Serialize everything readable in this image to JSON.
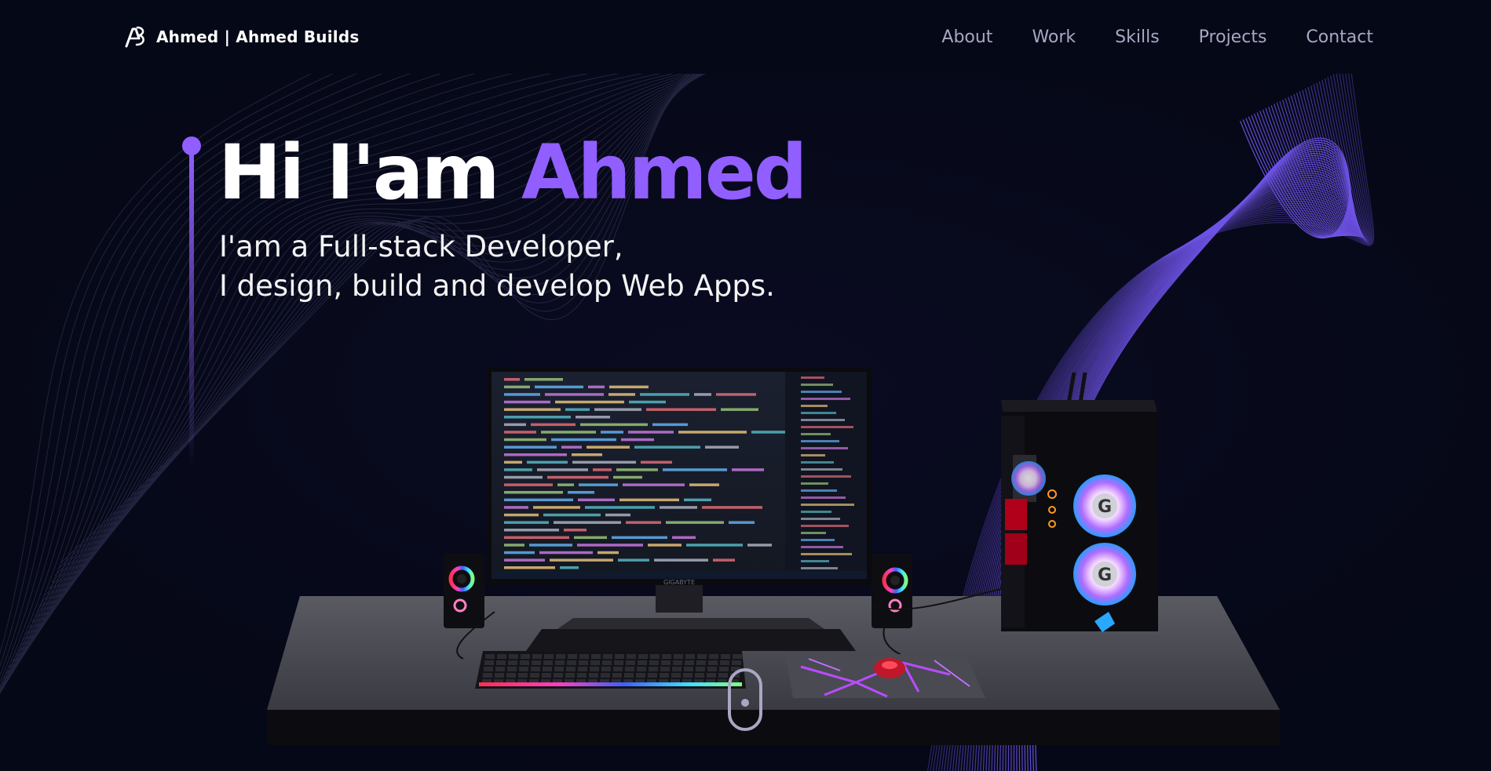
{
  "nav": {
    "logo_icon": "ab-monogram-logo",
    "brand": "Ahmed | Ahmed Builds",
    "links": [
      "About",
      "Work",
      "Skills",
      "Projects",
      "Contact"
    ]
  },
  "hero": {
    "title_prefix": "Hi I'am ",
    "title_name": "Ahmed",
    "subtitle_line1": "I'am a Full-stack Developer,",
    "subtitle_line2": "I design, build and develop Web Apps."
  },
  "scene": {
    "monitor_brand": "GIGABYTE",
    "description_icon": "desktop-computer-setup"
  },
  "scroll_indicator_icon": "mouse-scroll-icon",
  "colors": {
    "background": "#050816",
    "accent": "#915eff",
    "nav_text": "#aaa6c3",
    "white": "#ffffff"
  }
}
